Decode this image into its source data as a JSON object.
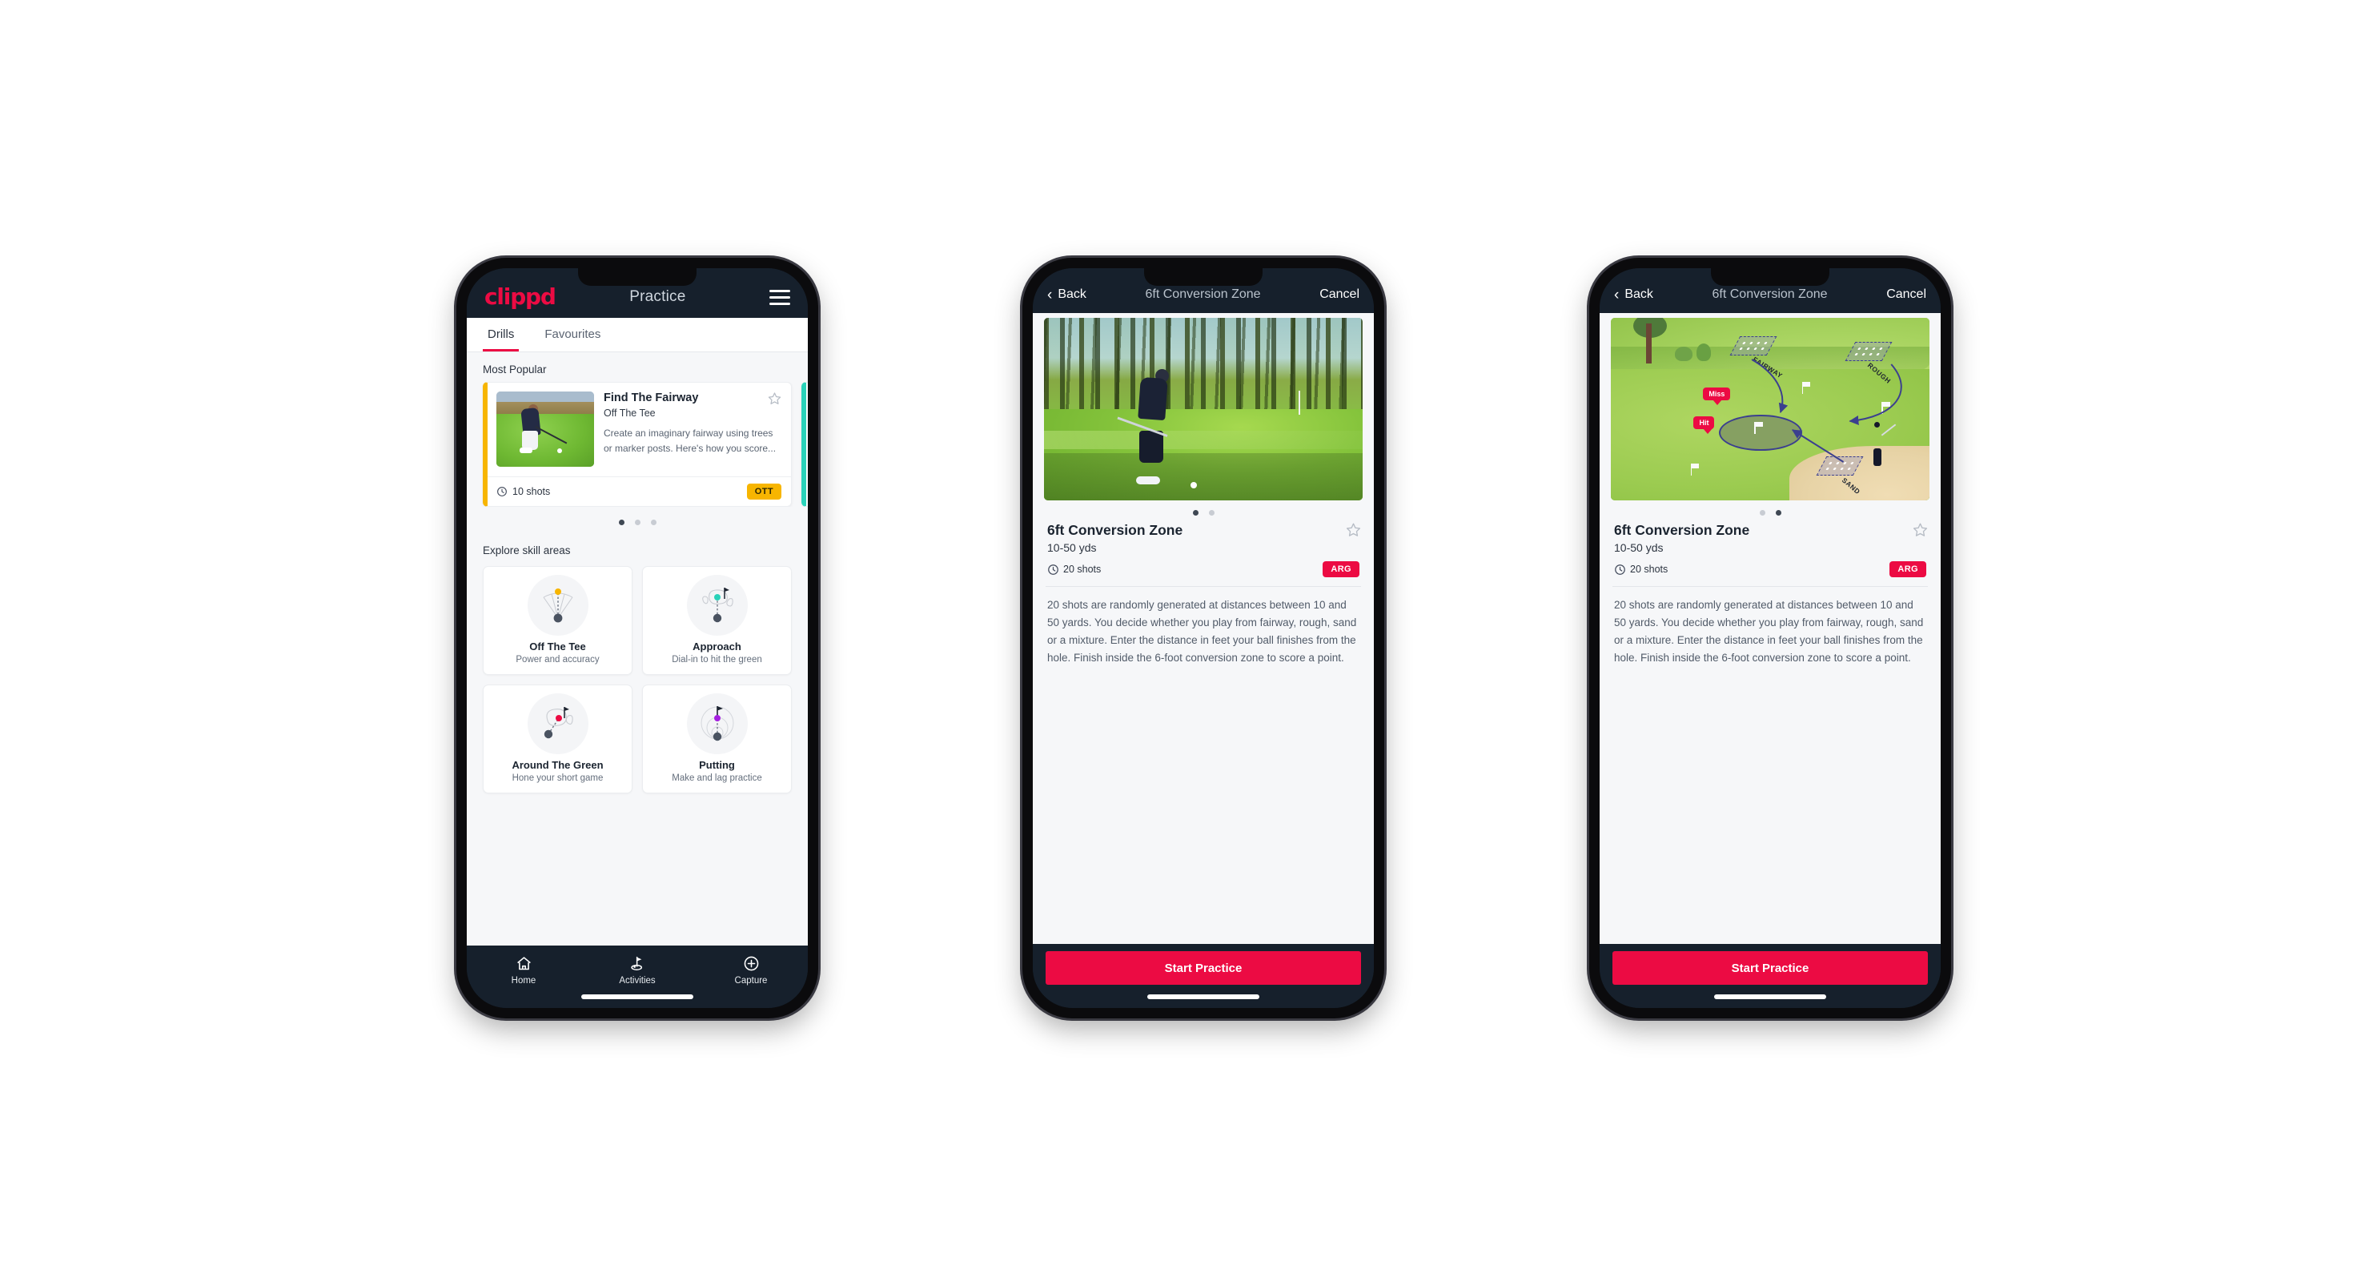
{
  "brand": {
    "logo_text": "clippd",
    "accent_pink": "#ec0b43",
    "header_dark": "#16202c",
    "badge_amber": "#f7b500",
    "badge_teal": "#2ad2b9"
  },
  "phone1": {
    "header": {
      "logo": "clippd",
      "title": "Practice",
      "menu_icon": "hamburger-icon"
    },
    "tabs": [
      {
        "label": "Drills",
        "active": true
      },
      {
        "label": "Favourites",
        "active": false
      }
    ],
    "sections": {
      "most_popular_label": "Most Popular",
      "explore_label": "Explore skill areas"
    },
    "featured_drill": {
      "title": "Find The Fairway",
      "subtitle": "Off The Tee",
      "description": "Create an imaginary fairway using trees or marker posts. Here's how you score...",
      "shots": "10 shots",
      "badge": "OTT",
      "badge_color": "#f7b500",
      "favourite_icon": "star-outline-icon",
      "shots_icon": "clock-icon",
      "accent_color": "#f7b500"
    },
    "carousel_dots": {
      "count": 3,
      "active_index": 0
    },
    "skill_areas": [
      {
        "title": "Off The Tee",
        "subtitle": "Power and accuracy",
        "icon": "tee-dispersion-icon",
        "dot_color": "#f7b500"
      },
      {
        "title": "Approach",
        "subtitle": "Dial-in to hit the green",
        "icon": "approach-green-icon",
        "dot_color": "#2ad2b9"
      },
      {
        "title": "Around The Green",
        "subtitle": "Hone your short game",
        "icon": "chip-green-icon",
        "dot_color": "#ec0b43"
      },
      {
        "title": "Putting",
        "subtitle": "Make and lag practice",
        "icon": "putting-rings-icon",
        "dot_color": "#a51fe0"
      }
    ],
    "bottom_nav": [
      {
        "label": "Home",
        "icon": "home-icon",
        "active": false
      },
      {
        "label": "Activities",
        "icon": "golf-flag-icon",
        "active": true
      },
      {
        "label": "Capture",
        "icon": "plus-circle-icon",
        "active": false
      }
    ]
  },
  "phone2": {
    "header": {
      "back_label": "Back",
      "back_icon": "chevron-left-icon",
      "title": "6ft Conversion Zone",
      "cancel_label": "Cancel"
    },
    "media": {
      "type": "photo",
      "alt": "golfer-chipping-photo"
    },
    "carousel_dots": {
      "count": 2,
      "active_index": 0
    },
    "drill": {
      "title": "6ft Conversion Zone",
      "yards": "10-50 yds",
      "shots": "20 shots",
      "badge": "ARG",
      "badge_color": "#ec0b43",
      "favourite_icon": "star-outline-icon",
      "shots_icon": "clock-icon",
      "description": "20 shots are randomly generated at distances between 10 and 50 yards. You decide whether you play from fairway, rough, sand or a mixture. Enter the distance in feet your ball finishes from the hole. Finish inside the 6-foot conversion zone to score a point."
    },
    "cta": {
      "label": "Start Practice"
    }
  },
  "phone3": {
    "header": {
      "back_label": "Back",
      "back_icon": "chevron-left-icon",
      "title": "6ft Conversion Zone",
      "cancel_label": "Cancel"
    },
    "media": {
      "type": "illustration",
      "alt": "golf-hole-diagram",
      "zone_labels": [
        "FAIRWAY",
        "ROUGH",
        "SAND"
      ],
      "pin_labels": [
        "Miss",
        "Hit"
      ]
    },
    "carousel_dots": {
      "count": 2,
      "active_index": 1
    },
    "drill": {
      "title": "6ft Conversion Zone",
      "yards": "10-50 yds",
      "shots": "20 shots",
      "badge": "ARG",
      "badge_color": "#ec0b43",
      "favourite_icon": "star-outline-icon",
      "shots_icon": "clock-icon",
      "description": "20 shots are randomly generated at distances between 10 and 50 yards. You decide whether you play from fairway, rough, sand or a mixture. Enter the distance in feet your ball finishes from the hole. Finish inside the 6-foot conversion zone to score a point."
    },
    "cta": {
      "label": "Start Practice"
    }
  }
}
